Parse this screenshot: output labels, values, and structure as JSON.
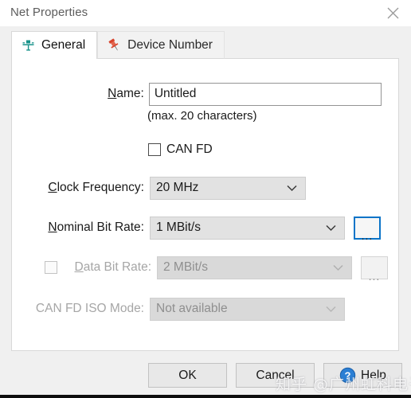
{
  "window": {
    "title": "Net Properties",
    "close_icon": "close-icon"
  },
  "tabs": [
    {
      "label": "General",
      "icon": "network-tee-icon",
      "selected": true
    },
    {
      "label": "Device Number",
      "icon": "pushpin-icon",
      "selected": false
    }
  ],
  "form": {
    "name": {
      "label_prefix": "N",
      "label_rest": "ame:",
      "value": "Untitled",
      "placeholder": "",
      "hint": "(max. 20 characters)"
    },
    "can_fd": {
      "label": "CAN FD",
      "checked": false
    },
    "clock_frequency": {
      "label_prefix": "C",
      "label_rest": "lock Frequency:",
      "value": "20 MHz",
      "chevron_icon": "chevron-down-icon",
      "enabled": true
    },
    "nominal_bit_rate": {
      "label_prefix": "N",
      "label_rest": "ominal Bit Rate:",
      "value": "1 MBit/s",
      "chevron_icon": "chevron-down-icon",
      "browse_label": "...",
      "browse_focused": true,
      "enabled": true
    },
    "data_bit_rate": {
      "label_prefix": "D",
      "label_rest": "ata Bit Rate:",
      "value": "2 MBit/s",
      "chevron_icon": "chevron-down-icon",
      "browse_label": "...",
      "checked": false,
      "enabled": false
    },
    "can_fd_iso_mode": {
      "label": "CAN FD ISO Mode:",
      "value": "Not available",
      "chevron_icon": "chevron-down-icon",
      "enabled": false
    }
  },
  "footer": {
    "ok_label": "OK",
    "cancel_label": "Cancel",
    "help_label": "Help",
    "help_icon": "help-question-icon"
  },
  "watermark": {
    "text": "知乎 @广州虹科电子"
  },
  "colors": {
    "focus_blue": "#0a74c8",
    "tab_icon_teal": "#1f9e8f",
    "pushpin_red": "#d8442c",
    "help_blue": "#2b7fd4",
    "dialog_bg": "#f0f0f0",
    "panel_bg": "#ffffff",
    "combo_bg": "#e2e2e2"
  }
}
